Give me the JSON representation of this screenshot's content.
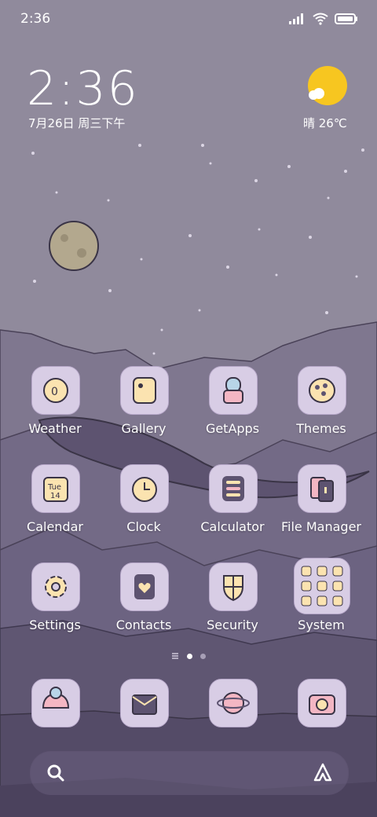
{
  "status": {
    "time": "2:36"
  },
  "clock": {
    "time": "2:36",
    "date": "7月26日 周三下午"
  },
  "weather": {
    "text": "晴 26℃"
  },
  "apps": [
    {
      "label": "Weather"
    },
    {
      "label": "Gallery"
    },
    {
      "label": "GetApps"
    },
    {
      "label": "Themes"
    },
    {
      "label": "Calendar",
      "day": "Tue",
      "date": "14"
    },
    {
      "label": "Clock"
    },
    {
      "label": "Calculator"
    },
    {
      "label": "File Manager"
    },
    {
      "label": "Settings"
    },
    {
      "label": "Contacts"
    },
    {
      "label": "Security"
    },
    {
      "label": "System"
    }
  ],
  "dock": [
    "phone",
    "mail",
    "browser",
    "camera"
  ]
}
